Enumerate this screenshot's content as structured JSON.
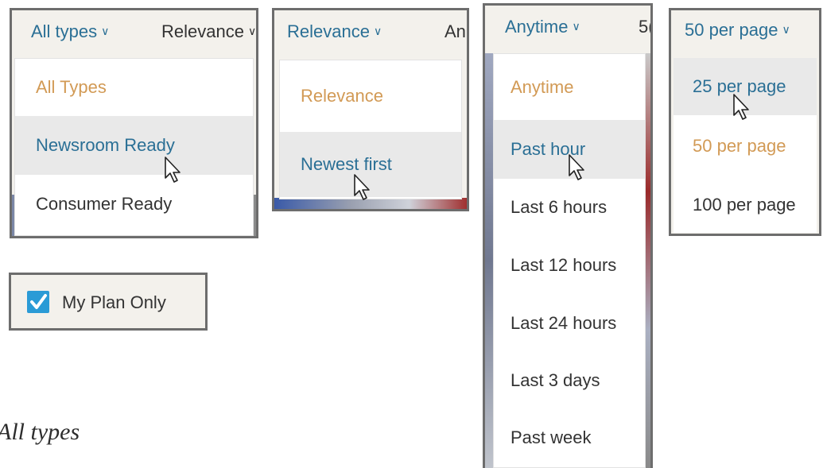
{
  "types_dropdown": {
    "button_label": "All types",
    "neighbor_label": "Relevance",
    "options": [
      "All Types",
      "Newsroom Ready",
      "Consumer Ready"
    ],
    "selected": "All Types",
    "hovered": "Newsroom Ready"
  },
  "sort_dropdown": {
    "button_label": "Relevance",
    "neighbor_label": "An",
    "options": [
      "Relevance",
      "Newest first"
    ],
    "selected": "Relevance",
    "hovered": "Newest first"
  },
  "time_dropdown": {
    "button_label": "Anytime",
    "neighbor_label": "5(",
    "options": [
      "Anytime",
      "Past hour",
      "Last 6 hours",
      "Last 12 hours",
      "Last 24 hours",
      "Last 3 days",
      "Past week"
    ],
    "selected": "Anytime",
    "hovered": "Past hour"
  },
  "page_size_dropdown": {
    "button_label": "50 per page",
    "options": [
      "25 per page",
      "50 per page",
      "100 per page"
    ],
    "selected": "50 per page",
    "hovered": "25 per page"
  },
  "my_plan": {
    "label": "My Plan Only",
    "checked": true
  },
  "caption": "All types",
  "colors": {
    "link_blue": "#2a6f95",
    "selected_orange": "#d29a55",
    "checkbox_blue": "#2a9bd6",
    "panel_border": "#6d6d6d"
  }
}
